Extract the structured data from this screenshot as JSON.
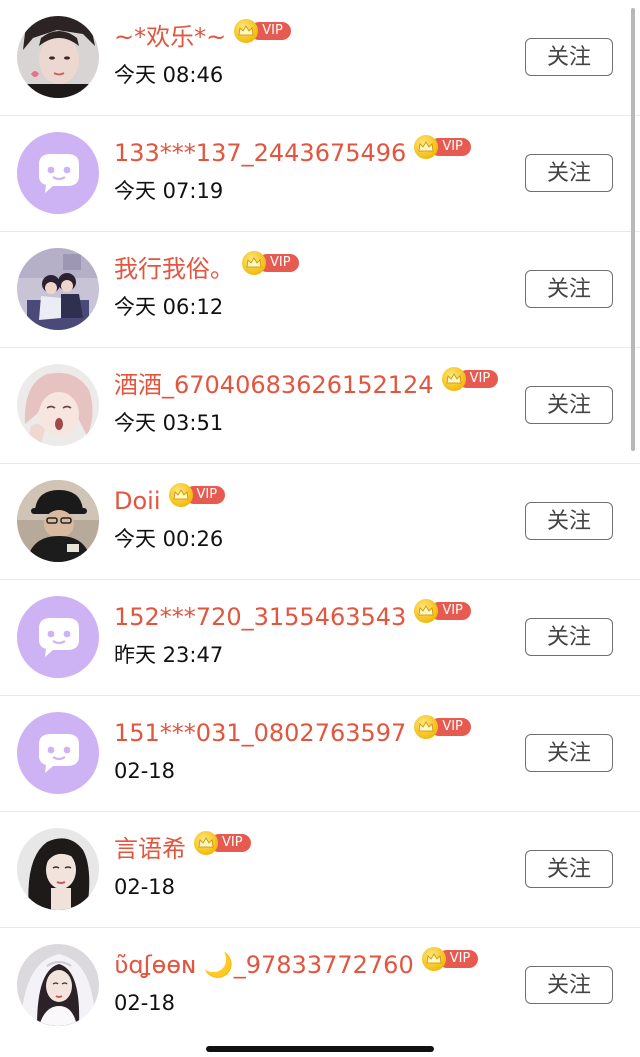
{
  "followers": [
    {
      "name": "~*欢乐*~",
      "time": "今天 08:46",
      "vip": "VIP",
      "button": "关注",
      "avatar": "photo-man"
    },
    {
      "name": "133***137_2443675496",
      "time": "今天 07:19",
      "vip": "VIP",
      "button": "关注",
      "avatar": "default-chat"
    },
    {
      "name": "我行我俗。",
      "time": "今天 06:12",
      "vip": "VIP",
      "button": "关注",
      "avatar": "illustration-couple"
    },
    {
      "name": "酒酒_67040683626152124",
      "time": "今天 03:51",
      "vip": "VIP",
      "button": "关注",
      "avatar": "illustration-girl"
    },
    {
      "name": "Doii",
      "time": "今天 00:26",
      "vip": "VIP",
      "button": "关注",
      "avatar": "photo-cap"
    },
    {
      "name": "152***720_3155463543",
      "time": "昨天 23:47",
      "vip": "VIP",
      "button": "关注",
      "avatar": "default-chat"
    },
    {
      "name": "151***031_0802763597",
      "time": "02-18",
      "vip": "VIP",
      "button": "关注",
      "avatar": "default-chat"
    },
    {
      "name": "言语希",
      "time": "02-18",
      "vip": "VIP",
      "button": "关注",
      "avatar": "photo-woman"
    },
    {
      "name": "ʋ̃ɑʆɵɵɴ 🌙_97833772760",
      "time": "02-18",
      "vip": "VIP",
      "button": "关注",
      "avatar": "photo-bride"
    }
  ],
  "colors": {
    "name": "#e2553e",
    "vip_tag": "#e65a50",
    "default_avatar": "#cdb3f3"
  }
}
